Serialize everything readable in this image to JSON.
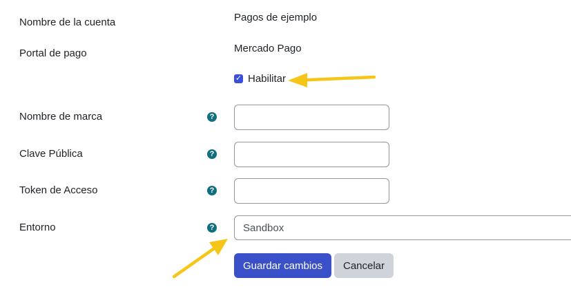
{
  "form": {
    "account_name": {
      "label": "Nombre de la cuenta",
      "value": "Pagos de ejemplo"
    },
    "gateway": {
      "label": "Portal de pago",
      "value": "Mercado Pago"
    },
    "enable": {
      "label": "Habilitar",
      "checked": true
    },
    "brand_name": {
      "label": "Nombre de marca",
      "value": "",
      "help_icon": "question-circle-icon"
    },
    "public_key": {
      "label": "Clave Pública",
      "value": "",
      "help_icon": "question-circle-icon"
    },
    "access_token": {
      "label": "Token de Acceso",
      "value": "",
      "help_icon": "question-circle-icon"
    },
    "environment": {
      "label": "Entorno",
      "selected": "Sandbox",
      "help_icon": "question-circle-icon"
    }
  },
  "buttons": {
    "save_label": "Guardar cambios",
    "cancel_label": "Cancelar"
  },
  "icons": {
    "help": "?",
    "check": "✓"
  },
  "colors": {
    "primary": "#3a50c8",
    "secondary": "#ced4da",
    "help_icon": "#0f6f81",
    "annotation_arrow": "#f5c518"
  }
}
